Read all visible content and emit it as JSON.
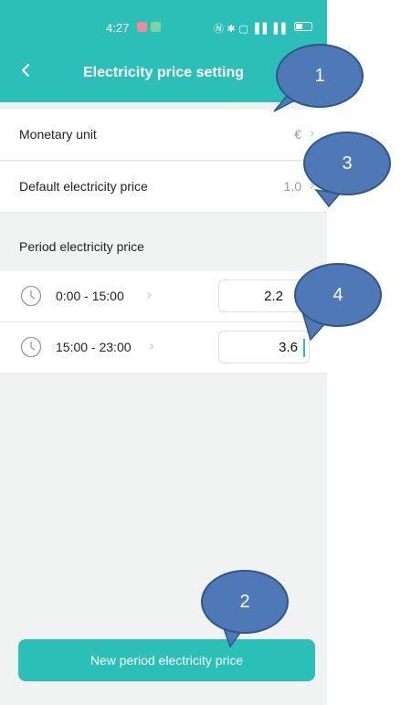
{
  "status_bar": {
    "time": "4:27",
    "icons_text": "Ⓝ ✱ ▢ ▐▐ ▐▐"
  },
  "header": {
    "back_icon": "chevron-left-icon",
    "title": "Electricity price setting"
  },
  "settings": {
    "monetary_unit": {
      "label": "Monetary unit",
      "value": "€"
    },
    "default_price": {
      "label": "Default electricity price",
      "value": "1.0"
    }
  },
  "period": {
    "section_label": "Period electricity price",
    "items": [
      {
        "range": "0:00 - 15:00",
        "price": "2.2"
      },
      {
        "range": "15:00 - 23:00",
        "price": "3.6"
      }
    ]
  },
  "add_button_label": "New period electricity price",
  "callouts": [
    "1",
    "2",
    "3",
    "4"
  ],
  "colors": {
    "accent": "#2bbfb8",
    "callout": "#4f79b6"
  }
}
